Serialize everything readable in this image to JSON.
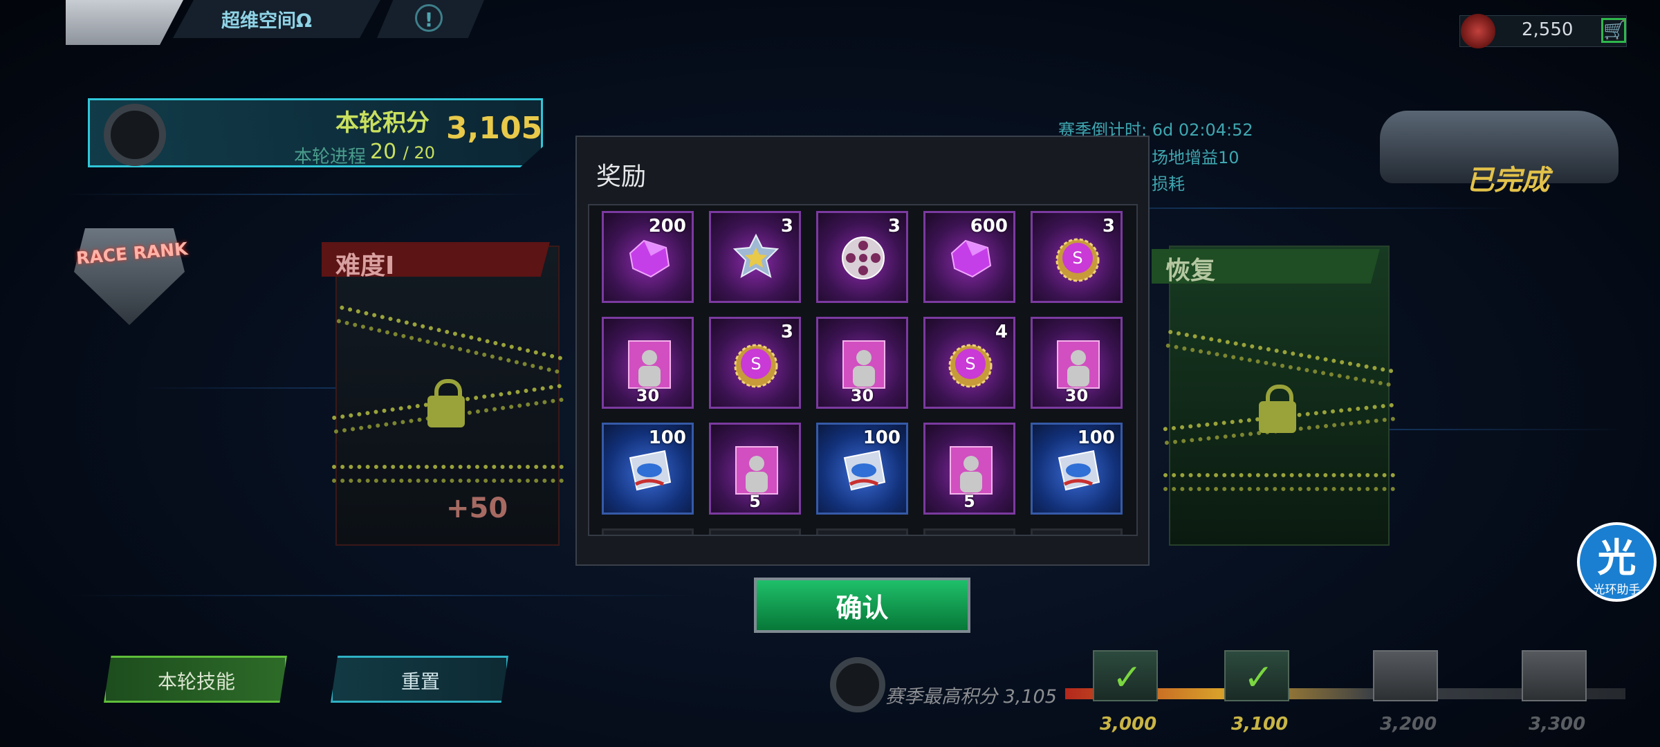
{
  "topbar": {
    "title": "超维空间Ω",
    "info_symbol": "!",
    "currency_value": "2,550",
    "cart_symbol": "🛒"
  },
  "score_panel": {
    "label": "本轮积分",
    "value": "3,105",
    "progress_label": "本轮进程",
    "progress_current": "20",
    "progress_total": "/ 20"
  },
  "race_rank": "RACE RANK",
  "left_card": {
    "title": "难度I",
    "bonus": "+50"
  },
  "right_card": {
    "title": "恢复"
  },
  "season": {
    "countdown": "赛季倒计时: 6d 02:04:52",
    "line2": "场地增益10",
    "line3": "损耗",
    "status": "已完成"
  },
  "modal": {
    "title": "奖励",
    "confirm_label": "确认",
    "items": [
      {
        "icon": "purple-gem-icon",
        "theme": "purple",
        "count": "200",
        "pos": "tr"
      },
      {
        "icon": "police-badge-icon",
        "theme": "purple",
        "count": "3",
        "pos": "tr"
      },
      {
        "icon": "film-reel-icon",
        "theme": "purple",
        "count": "3",
        "pos": "tr"
      },
      {
        "icon": "purple-gem-icon",
        "theme": "purple",
        "count": "600",
        "pos": "tr"
      },
      {
        "icon": "bottle-cap-icon",
        "theme": "purple",
        "count": "3",
        "pos": "tr"
      },
      {
        "icon": "character-card-icon",
        "theme": "purple",
        "count": "30",
        "pos": "b"
      },
      {
        "icon": "bottle-cap-icon",
        "theme": "purple",
        "count": "3",
        "pos": "tr"
      },
      {
        "icon": "character-card-icon",
        "theme": "purple",
        "count": "30",
        "pos": "b"
      },
      {
        "icon": "bottle-cap-icon",
        "theme": "purple",
        "count": "4",
        "pos": "tr"
      },
      {
        "icon": "character-card-icon",
        "theme": "purple",
        "count": "30",
        "pos": "b"
      },
      {
        "icon": "blue-emblem-icon",
        "theme": "blue",
        "count": "100",
        "pos": "tr"
      },
      {
        "icon": "character-card-icon",
        "theme": "purple",
        "count": "5",
        "pos": "b"
      },
      {
        "icon": "blue-emblem-icon",
        "theme": "blue",
        "count": "100",
        "pos": "tr"
      },
      {
        "icon": "character-card-icon",
        "theme": "purple",
        "count": "5",
        "pos": "b"
      },
      {
        "icon": "blue-emblem-icon",
        "theme": "blue",
        "count": "100",
        "pos": "tr"
      }
    ]
  },
  "bottom": {
    "skill_label": "本轮技能",
    "reset_label": "重置",
    "best_score": "赛季最高积分 3,105",
    "milestones": [
      {
        "value": "3,000",
        "claimed": true
      },
      {
        "value": "3,100",
        "claimed": true
      },
      {
        "value": "3,200",
        "claimed": false
      },
      {
        "value": "3,300",
        "claimed": false
      }
    ]
  },
  "helper": {
    "char": "光",
    "label": "光环助手"
  },
  "colors": {
    "accent_green": "#1fc06a",
    "gold": "#e8c94a",
    "cyan": "#2fc7d9"
  }
}
